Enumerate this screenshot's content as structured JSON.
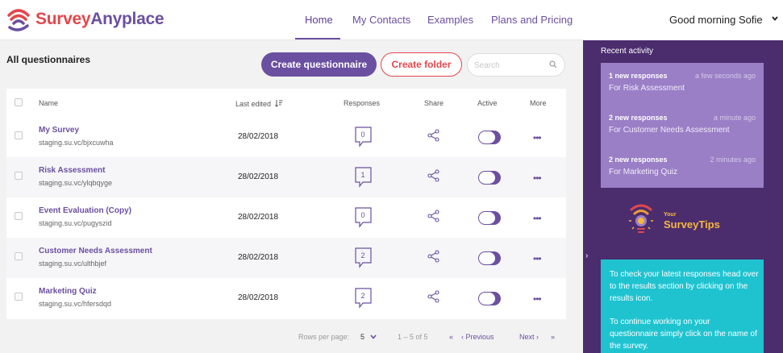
{
  "brand": {
    "part1": "Survey",
    "part2": "Anyplace"
  },
  "nav": {
    "items": [
      "Home",
      "My Contacts",
      "Examples",
      "Plans and Pricing"
    ],
    "active": "Home"
  },
  "user": {
    "greeting": "Good morning Sofie"
  },
  "main": {
    "title": "All questionnaires",
    "create_label": "Create questionnaire",
    "folder_label": "Create folder",
    "search_placeholder": "Search"
  },
  "table": {
    "headers": {
      "name": "Name",
      "last_edited": "Last edited",
      "responses": "Responses",
      "share": "Share",
      "active": "Active",
      "more": "More"
    },
    "rows": [
      {
        "title": "My Survey",
        "url": "staging.su.vc/bjxcuwha",
        "date": "28/02/2018",
        "responses": "0",
        "active": true
      },
      {
        "title": "Risk Assessment",
        "url": "staging.su.vc/ylqbqyge",
        "date": "28/02/2018",
        "responses": "1",
        "active": true
      },
      {
        "title": "Event Evaluation (Copy)",
        "url": "staging.su.vc/pugyszid",
        "date": "28/02/2018",
        "responses": "0",
        "active": true
      },
      {
        "title": "Customer Needs Assessment",
        "url": "staging.su.vc/ulthbjef",
        "date": "28/02/2018",
        "responses": "2",
        "active": true
      },
      {
        "title": "Marketing Quiz",
        "url": "staging.su.vc/hfersdqd",
        "date": "28/02/2018",
        "responses": "2",
        "active": true
      }
    ],
    "more_glyph": "•••"
  },
  "pagination": {
    "rows_label": "Rows per page:",
    "rows_value": "5",
    "range": "1 – 5 of 5",
    "first": "«",
    "prev": "‹ Previous",
    "next": "Next ›",
    "last": "»"
  },
  "right_panel": {
    "collapse_glyph": "›",
    "recent_title": "Recent activity",
    "activity": [
      {
        "headline": "1 new responses",
        "time": "a few seconds ago",
        "subject": "For Risk Assessment"
      },
      {
        "headline": "2 new responses",
        "time": "a minute ago",
        "subject": "For Customer Needs Assessment"
      },
      {
        "headline": "2 new responses",
        "time": "2 minutes ago",
        "subject": "For Marketing Quiz"
      }
    ],
    "tips_small": "Your",
    "tips_big": "SurveyTips",
    "tips": [
      "To check your latest responses head over to the results section by clicking on the results icon.",
      "To continue working on your questionnaire simply click on the name of the survey."
    ]
  },
  "colors": {
    "brand_purple": "#6b4fa0",
    "brand_red": "#e2474d",
    "panel_bg": "#4b2d6e",
    "activity_card": "#9a7fc6",
    "tips_card": "#1fc3d0",
    "tips_accent": "#f6b73c"
  }
}
